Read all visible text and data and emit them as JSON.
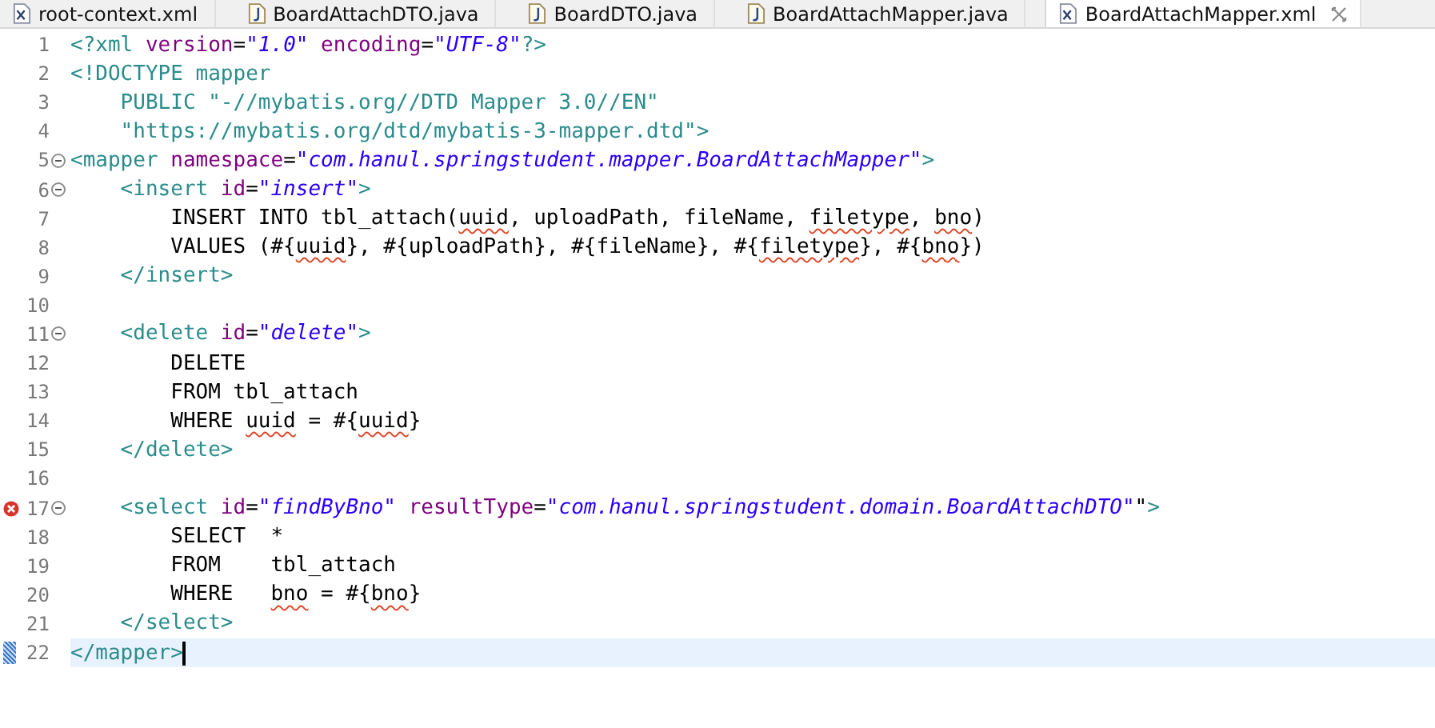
{
  "tabs": [
    {
      "label": "root-context.xml",
      "kind": "xml",
      "selected": false,
      "closable": false
    },
    {
      "label": "BoardAttachDTO.java",
      "kind": "java",
      "selected": false,
      "closable": false
    },
    {
      "label": "BoardDTO.java",
      "kind": "java",
      "selected": false,
      "closable": false
    },
    {
      "label": "BoardAttachMapper.java",
      "kind": "java",
      "selected": false,
      "closable": false
    },
    {
      "label": "BoardAttachMapper.xml",
      "kind": "xml",
      "selected": true,
      "closable": true
    }
  ],
  "lines": [
    {
      "n": "1",
      "fold": false,
      "error": false,
      "current": false,
      "tokens": [
        {
          "t": "<?xml ",
          "kind": "tag"
        },
        {
          "t": "version",
          "kind": "attr"
        },
        {
          "t": "=",
          "kind": "text"
        },
        {
          "t": "\"1.0\"",
          "kind": "value"
        },
        {
          "t": " encoding",
          "kind": "attr"
        },
        {
          "t": "=",
          "kind": "text"
        },
        {
          "t": "\"UTF-8\"",
          "kind": "value"
        },
        {
          "t": "?>",
          "kind": "tag"
        }
      ]
    },
    {
      "n": "2",
      "fold": false,
      "error": false,
      "current": false,
      "tokens": [
        {
          "t": "<!DOCTYPE mapper",
          "kind": "tag"
        }
      ]
    },
    {
      "n": "3",
      "fold": false,
      "error": false,
      "current": false,
      "tokens": [
        {
          "t": "    PUBLIC \"-//mybatis.org//DTD Mapper 3.0//EN\"",
          "kind": "tag"
        }
      ]
    },
    {
      "n": "4",
      "fold": false,
      "error": false,
      "current": false,
      "tokens": [
        {
          "t": "    \"https://mybatis.org/dtd/mybatis-3-mapper.dtd\">",
          "kind": "tag"
        }
      ]
    },
    {
      "n": "5",
      "fold": true,
      "error": false,
      "current": false,
      "tokens": [
        {
          "t": "<mapper ",
          "kind": "tag"
        },
        {
          "t": "namespace",
          "kind": "attr"
        },
        {
          "t": "=",
          "kind": "text"
        },
        {
          "t": "\"com.hanul.springstudent.mapper.BoardAttachMapper\"",
          "kind": "value"
        },
        {
          "t": ">",
          "kind": "tag"
        }
      ]
    },
    {
      "n": "6",
      "fold": true,
      "error": false,
      "current": false,
      "tokens": [
        {
          "t": "    <insert ",
          "kind": "tag"
        },
        {
          "t": "id",
          "kind": "attr"
        },
        {
          "t": "=",
          "kind": "text"
        },
        {
          "t": "\"insert\"",
          "kind": "value"
        },
        {
          "t": ">",
          "kind": "tag"
        }
      ]
    },
    {
      "n": "7",
      "fold": false,
      "error": false,
      "current": false,
      "tokens": [
        {
          "t": "        INSERT INTO tbl_attach(",
          "kind": "text"
        },
        {
          "t": "uuid",
          "kind": "spell"
        },
        {
          "t": ", uploadPath, fileName, ",
          "kind": "text"
        },
        {
          "t": "filetype",
          "kind": "spell"
        },
        {
          "t": ", ",
          "kind": "text"
        },
        {
          "t": "bno",
          "kind": "spell"
        },
        {
          "t": ")",
          "kind": "text"
        }
      ]
    },
    {
      "n": "8",
      "fold": false,
      "error": false,
      "current": false,
      "tokens": [
        {
          "t": "        VALUES (#{",
          "kind": "text"
        },
        {
          "t": "uuid",
          "kind": "spell"
        },
        {
          "t": "}, #{uploadPath}, #{fileName}, #{",
          "kind": "text"
        },
        {
          "t": "filetype",
          "kind": "spell"
        },
        {
          "t": "}, #{",
          "kind": "text"
        },
        {
          "t": "bno",
          "kind": "spell"
        },
        {
          "t": "})",
          "kind": "text"
        }
      ]
    },
    {
      "n": "9",
      "fold": false,
      "error": false,
      "current": false,
      "tokens": [
        {
          "t": "    </insert>",
          "kind": "tag"
        }
      ]
    },
    {
      "n": "10",
      "fold": false,
      "error": false,
      "current": false
    },
    {
      "n": "11",
      "fold": true,
      "error": false,
      "current": false,
      "tokens": [
        {
          "t": "    <delete ",
          "kind": "tag"
        },
        {
          "t": "id",
          "kind": "attr"
        },
        {
          "t": "=",
          "kind": "text"
        },
        {
          "t": "\"delete\"",
          "kind": "value"
        },
        {
          "t": ">",
          "kind": "tag"
        }
      ]
    },
    {
      "n": "12",
      "fold": false,
      "error": false,
      "current": false,
      "tokens": [
        {
          "t": "        DELETE",
          "kind": "text"
        }
      ]
    },
    {
      "n": "13",
      "fold": false,
      "error": false,
      "current": false,
      "tokens": [
        {
          "t": "        FROM tbl_attach",
          "kind": "text"
        }
      ]
    },
    {
      "n": "14",
      "fold": false,
      "error": false,
      "current": false,
      "tokens": [
        {
          "t": "        WHERE ",
          "kind": "text"
        },
        {
          "t": "uuid",
          "kind": "spell"
        },
        {
          "t": " = #{",
          "kind": "text"
        },
        {
          "t": "uuid",
          "kind": "spell"
        },
        {
          "t": "}",
          "kind": "text"
        }
      ]
    },
    {
      "n": "15",
      "fold": false,
      "error": false,
      "current": false,
      "tokens": [
        {
          "t": "    </delete>",
          "kind": "tag"
        }
      ]
    },
    {
      "n": "16",
      "fold": false,
      "error": false,
      "current": false
    },
    {
      "n": "17",
      "fold": true,
      "error": true,
      "current": false,
      "tokens": [
        {
          "t": "    <select ",
          "kind": "tag"
        },
        {
          "t": "id",
          "kind": "attr"
        },
        {
          "t": "=",
          "kind": "text"
        },
        {
          "t": "\"findByBno\"",
          "kind": "value"
        },
        {
          "t": " resultType",
          "kind": "attr"
        },
        {
          "t": "=",
          "kind": "text"
        },
        {
          "t": "\"com.hanul.springstudent.domain.BoardAttachDTO\"",
          "kind": "value"
        },
        {
          "t": "\"",
          "kind": "text"
        },
        {
          "t": ">",
          "kind": "tag"
        }
      ]
    },
    {
      "n": "18",
      "fold": false,
      "error": false,
      "current": false,
      "tokens": [
        {
          "t": "        SELECT  *",
          "kind": "text"
        }
      ]
    },
    {
      "n": "19",
      "fold": false,
      "error": false,
      "current": false,
      "tokens": [
        {
          "t": "        FROM    tbl_attach",
          "kind": "text"
        }
      ]
    },
    {
      "n": "20",
      "fold": false,
      "error": false,
      "current": false,
      "tokens": [
        {
          "t": "        WHERE   ",
          "kind": "text"
        },
        {
          "t": "bno",
          "kind": "spell"
        },
        {
          "t": " = #{",
          "kind": "text"
        },
        {
          "t": "bno",
          "kind": "spell"
        },
        {
          "t": "}",
          "kind": "text"
        }
      ]
    },
    {
      "n": "21",
      "fold": false,
      "error": false,
      "current": false,
      "tokens": [
        {
          "t": "    </select>",
          "kind": "tag"
        }
      ]
    },
    {
      "n": "22",
      "fold": false,
      "error": false,
      "current": true,
      "tokens": [
        {
          "t": "</mapper>",
          "kind": "tag"
        }
      ]
    }
  ]
}
